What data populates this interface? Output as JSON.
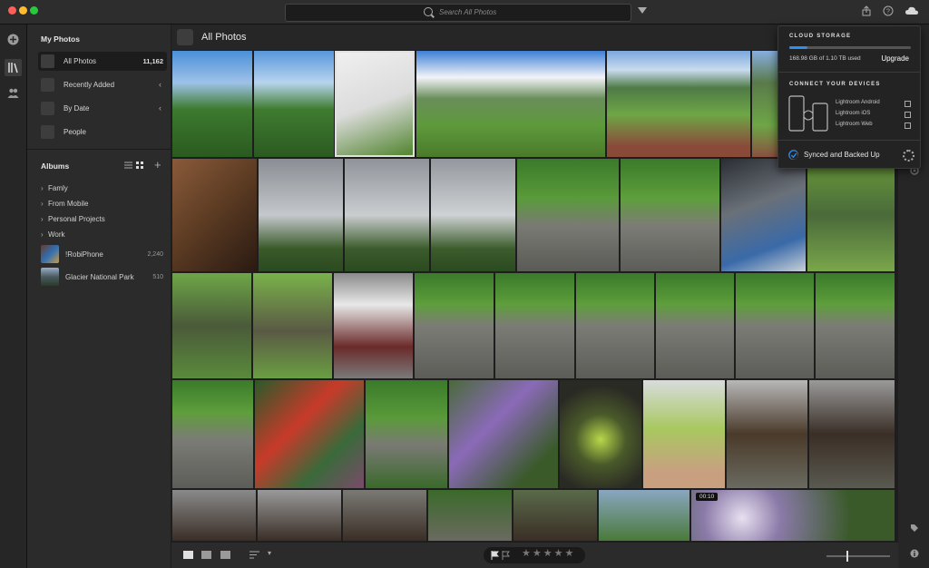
{
  "search": {
    "placeholder": "Search All Photos"
  },
  "sidebar": {
    "heading": "My Photos",
    "items": [
      {
        "label": "All Photos",
        "count": "11,162"
      },
      {
        "label": "Recently Added"
      },
      {
        "label": "By Date"
      },
      {
        "label": "People"
      }
    ],
    "albums_heading": "Albums",
    "albums": [
      {
        "label": "Famly"
      },
      {
        "label": "From Mobile"
      },
      {
        "label": "Personal Projects"
      },
      {
        "label": "Work"
      }
    ],
    "synced_albums": [
      {
        "label": "!RobiPhone",
        "count": "2,240"
      },
      {
        "label": "Glacier National Park",
        "count": "510"
      }
    ]
  },
  "main": {
    "title": "All Photos"
  },
  "video_badge": "00:10",
  "cloud": {
    "header": "CLOUD STORAGE",
    "usage": "168.98 GB of 1.10 TB used",
    "usage_fraction": 0.15,
    "upgrade": "Upgrade",
    "connect_header": "CONNECT YOUR DEVICES",
    "devices": [
      "Lightroom Android",
      "Lightroom iOS",
      "Lightroom Web"
    ],
    "status": "Synced and Backed Up"
  },
  "colors": {
    "accent": "#2f8ff0",
    "background": "#1e1e1e"
  }
}
